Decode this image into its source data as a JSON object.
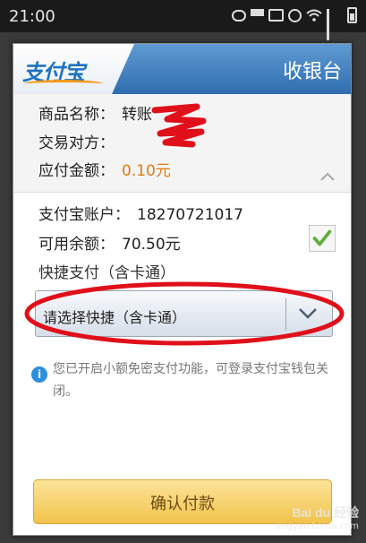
{
  "status_bar": {
    "time": "21:00"
  },
  "dialog": {
    "logo": "支付宝",
    "title": "收银台",
    "product_label": "商品名称：",
    "product_value": "转账",
    "counterparty_label": "交易对方：",
    "amount_label": "应付金额：",
    "amount_value": "0.10元",
    "account_label": "支付宝账户：",
    "account_value": "18270721017",
    "balance_label": "可用余额：",
    "balance_value": "70.50元",
    "balance_checked": true,
    "quickpay_label": "快捷支付（含卡通）",
    "select_value": "请选择快捷（含卡通）",
    "notice": "您已开启小额免密支付功能，可登录支付宝钱包关闭。",
    "confirm_button": "确认付款"
  },
  "watermark": {
    "text": "Bai du 经验",
    "url": "jingyan.baidu.com"
  },
  "colors": {
    "header_blue": "#2f6db0",
    "amount_orange": "#e07a12",
    "button_gold": "#f2c34a",
    "annotation_red": "#e0101a"
  }
}
